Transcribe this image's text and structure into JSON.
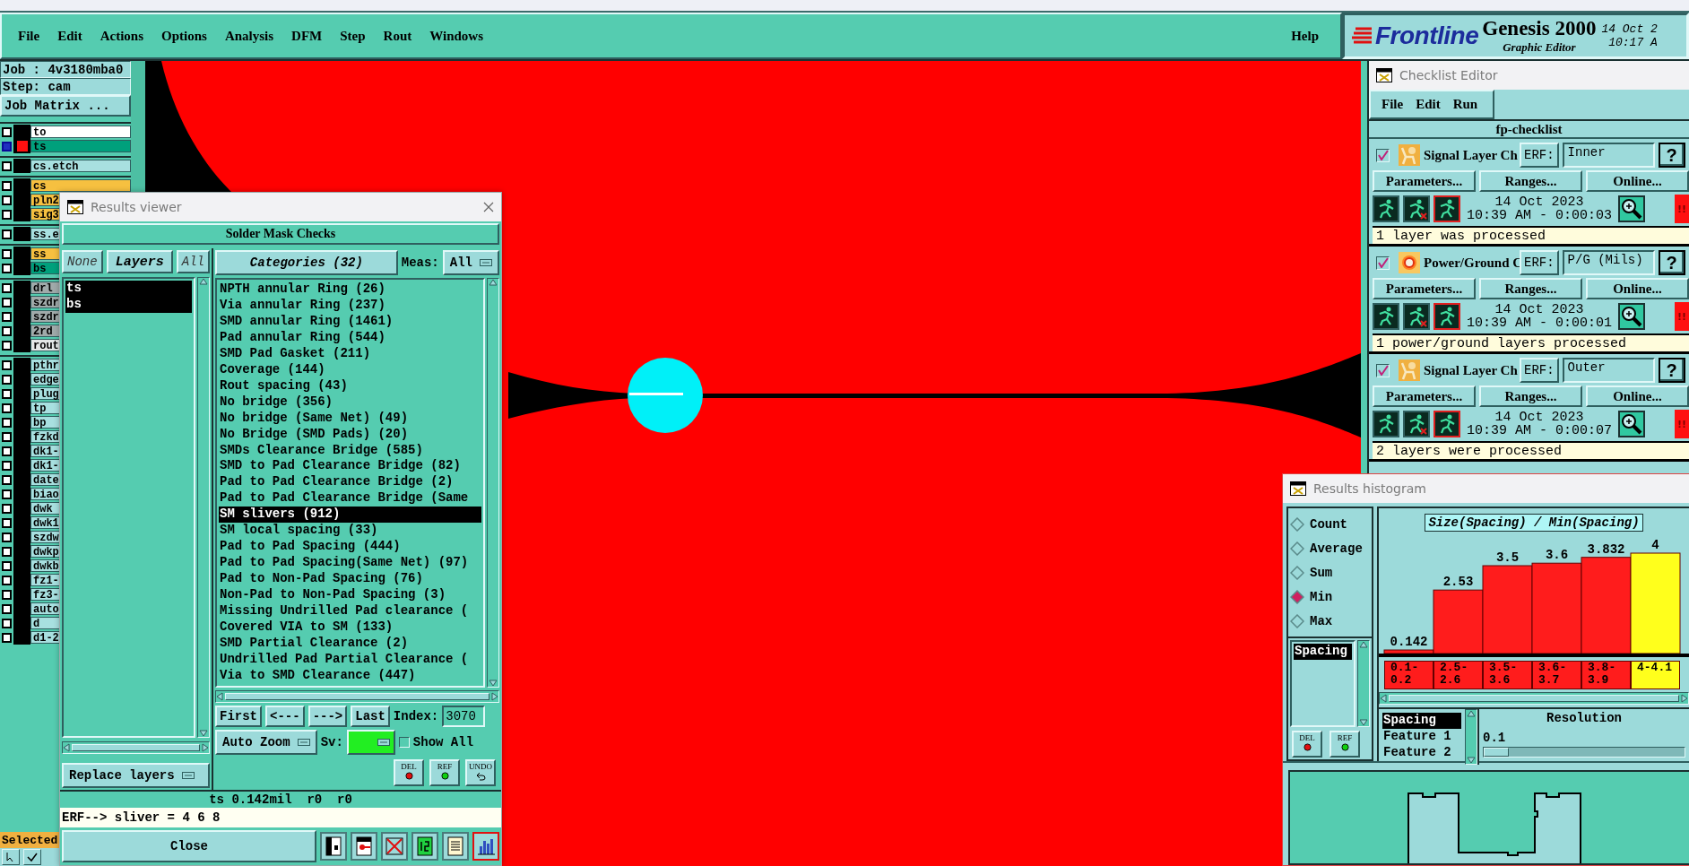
{
  "menu_bar": {
    "items": [
      "File",
      "Edit",
      "Actions",
      "Options",
      "Analysis",
      "DFM",
      "Step",
      "Rout",
      "Windows"
    ],
    "help": "Help"
  },
  "logo": {
    "brand": "Frontline",
    "product": "Genesis 2000",
    "subtitle": "Graphic Editor",
    "date": "14 Oct 2",
    "time": "10:17 A"
  },
  "job_panel": {
    "job": "Job : 4v3180mba0",
    "step": "Step: cam",
    "matrix_button": "Job Matrix ...",
    "layer_groups": [
      {
        "layers": [
          {
            "name": "to",
            "color": "#ffffff",
            "active": false
          },
          {
            "name": "ts",
            "color": "#00a07c",
            "active": true
          }
        ]
      },
      {
        "layers": [
          {
            "name": "cs.etch",
            "color": "#a8e0e0",
            "active": false
          }
        ]
      },
      {
        "layers": [
          {
            "name": "cs",
            "color": "#f6c040",
            "active": false
          },
          {
            "name": "pln2",
            "color": "#f6c040",
            "active": false
          },
          {
            "name": "sig3",
            "color": "#f6c040",
            "active": false
          }
        ]
      },
      {
        "layers": [
          {
            "name": "ss.e",
            "color": "#a8e0e0",
            "active": false
          }
        ]
      },
      {
        "layers": [
          {
            "name": "ss",
            "color": "#f6c040",
            "active": false
          },
          {
            "name": "bs",
            "color": "#00a07c",
            "active": false
          }
        ]
      },
      {
        "layers": [
          {
            "name": "drl",
            "color": "#a0aaaa",
            "active": false
          },
          {
            "name": "szdr",
            "color": "#a0aaaa",
            "active": false
          },
          {
            "name": "szdr",
            "color": "#a0aaaa",
            "active": false
          },
          {
            "name": "2rd",
            "color": "#a0aaaa",
            "active": false
          },
          {
            "name": "rout",
            "color": "#e4e8e8",
            "active": false
          }
        ]
      },
      {
        "layers": [
          {
            "name": "pthr",
            "color": "#a8e0e0",
            "active": false
          },
          {
            "name": "edge",
            "color": "#a8e0e0",
            "active": false
          },
          {
            "name": "plug",
            "color": "#a8e0e0",
            "active": false
          },
          {
            "name": "tp",
            "color": "#a8e0e0",
            "active": false
          },
          {
            "name": "bp",
            "color": "#a8e0e0",
            "active": false
          },
          {
            "name": "fzkd",
            "color": "#a8e0e0",
            "active": false
          },
          {
            "name": "dk1-",
            "color": "#a8e0e0",
            "active": false
          },
          {
            "name": "dk1-",
            "color": "#a8e0e0",
            "active": false
          },
          {
            "name": "date",
            "color": "#a8e0e0",
            "active": false
          },
          {
            "name": "biao",
            "color": "#a8e0e0",
            "active": false
          },
          {
            "name": "dwk",
            "color": "#a8e0e0",
            "active": false
          },
          {
            "name": "dwk1",
            "color": "#a8e0e0",
            "active": false
          },
          {
            "name": "szdw",
            "color": "#a8e0e0",
            "active": false
          },
          {
            "name": "dwkp",
            "color": "#a8e0e0",
            "active": false
          },
          {
            "name": "dwkb",
            "color": "#a8e0e0",
            "active": false
          },
          {
            "name": "fz1-",
            "color": "#a8e0e0",
            "active": false
          },
          {
            "name": "fz3-",
            "color": "#a8e0e0",
            "active": false
          },
          {
            "name": "auto",
            "color": "#a8e0e0",
            "active": false
          },
          {
            "name": "d",
            "color": "#a8e0e0",
            "active": false
          },
          {
            "name": "d1-2",
            "color": "#a8e0e0",
            "active": false
          }
        ]
      }
    ],
    "status": "Selected"
  },
  "results_viewer": {
    "title": "Results viewer",
    "heading": "Solder Mask Checks",
    "layer_buttons": [
      {
        "label": "None",
        "selected": false
      },
      {
        "label": "Layers",
        "selected": true
      },
      {
        "label": "All",
        "selected": false
      }
    ],
    "layers": [
      {
        "name": "ts",
        "selected": true
      },
      {
        "name": "bs",
        "selected": true
      }
    ],
    "replace": "Replace layers",
    "categories_button": "Categories (32)",
    "meas_label": "Meas:",
    "meas_value": "All",
    "categories": [
      {
        "label": "NPTH annular Ring (26)",
        "selected": false
      },
      {
        "label": "Via annular Ring (237)",
        "selected": false
      },
      {
        "label": "SMD annular Ring (1461)",
        "selected": false
      },
      {
        "label": "Pad annular Ring (544)",
        "selected": false
      },
      {
        "label": "SMD Pad Gasket (211)",
        "selected": false
      },
      {
        "label": "Coverage (144)",
        "selected": false
      },
      {
        "label": "Rout spacing (43)",
        "selected": false
      },
      {
        "label": "No bridge (356)",
        "selected": false
      },
      {
        "label": "No bridge (Same Net) (49)",
        "selected": false
      },
      {
        "label": "No Bridge (SMD Pads) (20)",
        "selected": false
      },
      {
        "label": "SMDs Clearance Bridge (585)",
        "selected": false
      },
      {
        "label": "SMD to Pad Clearance Bridge (82)",
        "selected": false
      },
      {
        "label": "Pad to Pad Clearance Bridge (2)",
        "selected": false
      },
      {
        "label": "Pad to Pad Clearance Bridge (Same",
        "selected": false
      },
      {
        "label": "SM slivers (912)",
        "selected": true
      },
      {
        "label": "SM local spacing (33)",
        "selected": false
      },
      {
        "label": "Pad to Pad Spacing (444)",
        "selected": false
      },
      {
        "label": "Pad to Pad Spacing(Same Net) (97)",
        "selected": false
      },
      {
        "label": "Pad to Non-Pad Spacing (76)",
        "selected": false
      },
      {
        "label": "Non-Pad to Non-Pad Spacing (3)",
        "selected": false
      },
      {
        "label": "Missing Undrilled Pad clearance (",
        "selected": false
      },
      {
        "label": "Covered VIA to SM (133)",
        "selected": false
      },
      {
        "label": "SMD Partial Clearance (2)",
        "selected": false
      },
      {
        "label": "Undrilled Pad Partial Clearance (",
        "selected": false
      },
      {
        "label": "Via to SMD Clearance (447)",
        "selected": false
      }
    ],
    "nav_buttons": [
      "First",
      "<---",
      "--->",
      "Last"
    ],
    "index_label": "Index:",
    "index_value": "3070",
    "zoom_mode": "Auto Zoom",
    "sv_label": "Sv:",
    "show_all": {
      "label": "Show All",
      "checked": false
    },
    "edit_buttons": [
      {
        "kind": "delete",
        "label": "DEL"
      },
      {
        "kind": "refresh",
        "label": "REF"
      },
      {
        "kind": "undo",
        "label": "UNDO"
      }
    ],
    "status": "ts 0.142mil  r0  r0",
    "erf_line": "ERF--> sliver = 4 6 8",
    "close_button": "Close",
    "tools": [
      {
        "kind": "layers",
        "selected": false
      },
      {
        "kind": "marker",
        "selected": false
      },
      {
        "kind": "erf_off",
        "selected": false
      },
      {
        "kind": "numbered",
        "selected": false
      },
      {
        "kind": "report",
        "selected": false
      },
      {
        "kind": "histogram",
        "selected": true
      }
    ]
  },
  "checklist_editor": {
    "title": "Checklist Editor",
    "menu": [
      "File",
      "Edit",
      "Run"
    ],
    "name": "fp-checklist",
    "checks": [
      {
        "enabled": true,
        "kind": "signal",
        "name": "Signal Layer Ch",
        "erf_label": "ERF:",
        "erf": "Inner",
        "help": "?",
        "buttons": [
          "Parameters...",
          "Ranges...",
          "Online..."
        ],
        "date": "14 Oct 2023",
        "time": "10:39 AM - 0:00:03",
        "alert": "!!",
        "result": "1 layer was processed"
      },
      {
        "enabled": true,
        "kind": "power_ground",
        "name": "Power/Ground C",
        "erf_label": "ERF:",
        "erf": "P/G (Mils)",
        "help": "?",
        "buttons": [
          "Parameters...",
          "Ranges...",
          "Online..."
        ],
        "date": "14 Oct 2023",
        "time": "10:39 AM - 0:00:01",
        "alert": "!!",
        "result": "1 power/ground layers processed"
      },
      {
        "enabled": true,
        "kind": "signal",
        "name": "Signal Layer Ch",
        "erf_label": "ERF:",
        "erf": "Outer",
        "help": "?",
        "buttons": [
          "Parameters...",
          "Ranges...",
          "Online..."
        ],
        "date": "14 Oct 2023",
        "time": "10:39 AM - 0:00:07",
        "alert": "!!",
        "result": "2 layers were processed"
      }
    ]
  },
  "results_histogram": {
    "title": "Results histogram",
    "modes": [
      {
        "label": "Count",
        "selected": false
      },
      {
        "label": "Average",
        "selected": false
      },
      {
        "label": "Sum",
        "selected": false
      },
      {
        "label": "Min",
        "selected": true
      },
      {
        "label": "Max",
        "selected": false
      }
    ],
    "measures": [
      {
        "label": "Spacing",
        "selected": true
      }
    ],
    "edit_buttons": [
      {
        "kind": "delete",
        "label": "DEL"
      },
      {
        "kind": "refresh",
        "label": "REF"
      }
    ],
    "chart_data": {
      "type": "bar",
      "title": "Size(Spacing) / Min(Spacing)",
      "categories": [
        "0.1-0.2",
        "2.5-2.6",
        "3.5-3.6",
        "3.6-3.7",
        "3.8-3.9",
        "4-4.1"
      ],
      "data_labels": true,
      "ylim": [
        0,
        4
      ],
      "series": [
        {
          "color": "#ff1c1c",
          "values": [
            0.142,
            2.53,
            3.5,
            3.6,
            3.832,
            null
          ]
        },
        {
          "color": "#ffff1c",
          "values": [
            null,
            null,
            null,
            null,
            null,
            4
          ]
        }
      ]
    },
    "fields": [
      {
        "label": "Spacing",
        "selected": true
      },
      {
        "label": "Feature 1",
        "selected": false
      },
      {
        "label": "Feature 2",
        "selected": false
      }
    ],
    "resolution_label": "Resolution",
    "resolution": "0.1",
    "resolution_slider": {
      "level": 0
    }
  }
}
